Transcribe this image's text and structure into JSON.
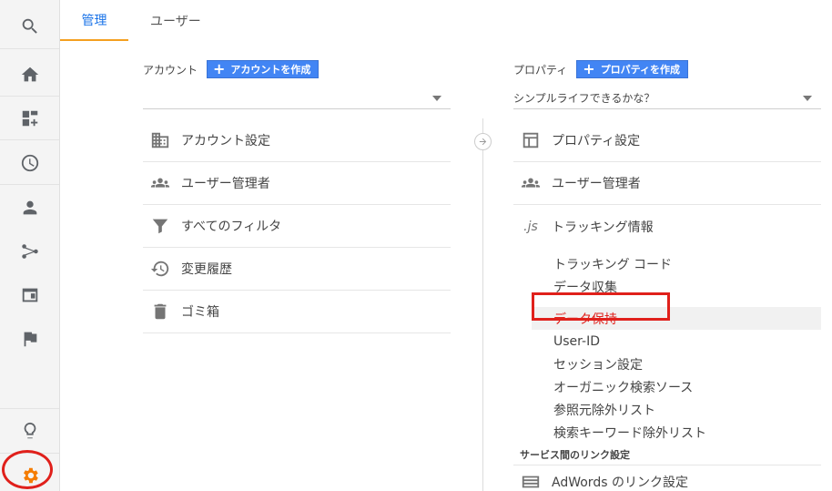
{
  "tabs": {
    "admin": "管理",
    "users": "ユーザー"
  },
  "rail": [
    "search-icon",
    "home-icon",
    "customization-icon",
    "realtime-icon",
    "audience-icon",
    "acquisition-icon",
    "behavior-icon",
    "conversions-icon",
    "discover-icon",
    "admin-gear-icon"
  ],
  "account": {
    "label": "アカウント",
    "create_label": "アカウントを作成",
    "selected": "",
    "items": [
      {
        "label": "アカウント設定",
        "icon": "building-icon"
      },
      {
        "label": "ユーザー管理者",
        "icon": "group-icon"
      },
      {
        "label": "すべてのフィルタ",
        "icon": "filter-icon"
      },
      {
        "label": "変更履歴",
        "icon": "history-icon"
      },
      {
        "label": "ゴミ箱",
        "icon": "trash-icon"
      }
    ]
  },
  "property": {
    "label": "プロパティ",
    "create_label": "プロパティを作成",
    "selected": "シンプルライフできるかな？",
    "items": [
      {
        "label": "プロパティ設定",
        "icon": "window-icon"
      },
      {
        "label": "ユーザー管理者",
        "icon": "group-icon"
      },
      {
        "label": "トラッキング情報",
        "icon": "js-icon",
        "icon_text": ".js"
      }
    ],
    "tracking_sub": [
      "トラッキング コード",
      "データ収集",
      "データ保持",
      "User-ID",
      "セッション設定",
      "オーガニック検索ソース",
      "参照元除外リスト",
      "検索キーワード除外リスト"
    ],
    "selected_sub": "データ保持",
    "services_label": "サービス間のリンク設定",
    "adwords_label": "AdWords のリンク設定"
  },
  "colors": {
    "accent": "#1a73e8",
    "create_button": "#4285f4",
    "highlight_red": "#e0201b",
    "gear": "#f57c00"
  }
}
